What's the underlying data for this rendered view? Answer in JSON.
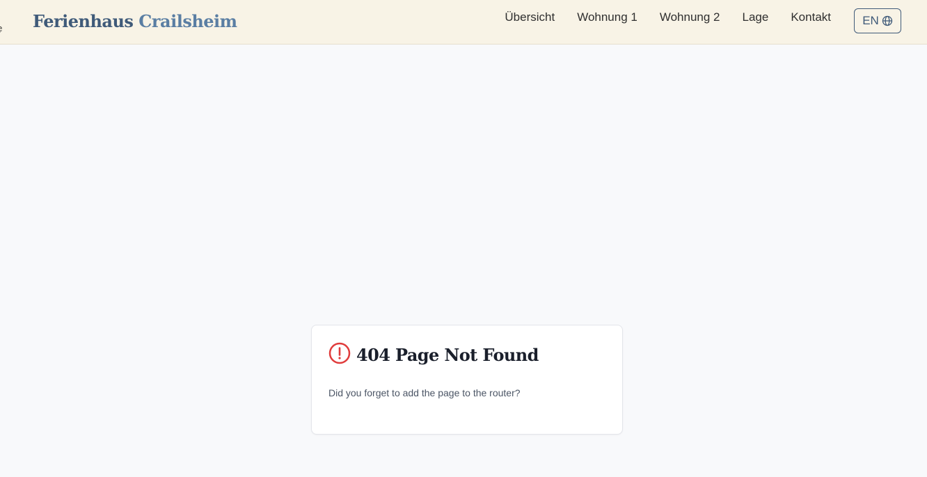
{
  "header": {
    "edge_glyph": "ẹ",
    "brand_first": "Ferienhaus",
    "brand_second": "Crailsheim",
    "nav": [
      {
        "label": "Übersicht"
      },
      {
        "label": "Wohnung 1"
      },
      {
        "label": "Wohnung 2"
      },
      {
        "label": "Lage"
      },
      {
        "label": "Kontakt"
      }
    ],
    "language_label": "EN",
    "language_icon": "globe-icon"
  },
  "error_card": {
    "icon": "alert-circle-icon",
    "title": "404 Page Not Found",
    "message": "Did you forget to add the page to the router?"
  },
  "colors": {
    "header_bg": "#f8f3e6",
    "brand_dark": "#3f5a79",
    "brand_light": "#5a7ea3",
    "page_bg": "#f8f9fb",
    "error_red": "#e03c3c"
  }
}
